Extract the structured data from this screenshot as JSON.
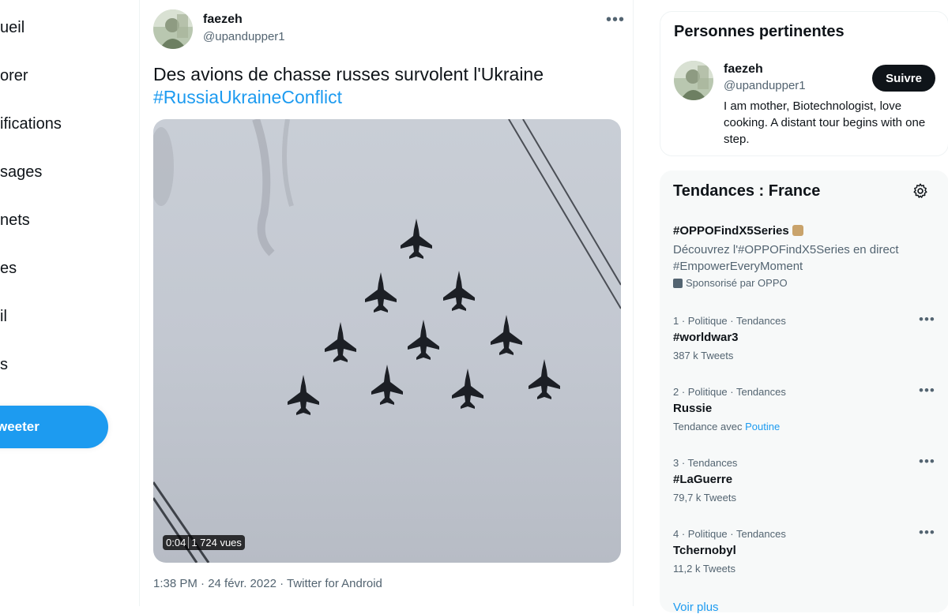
{
  "nav": {
    "items": [
      "ueil",
      "orer",
      "ifications",
      "sages",
      "nets",
      "es",
      "il",
      "s"
    ],
    "tweet_button": "weeter"
  },
  "tweet": {
    "author_name": "faezeh",
    "author_handle": "@upandupper1",
    "more_icon": "more-horizontal-icon",
    "text": "Des avions de chasse russes survolent l'Ukraine",
    "hashtag": "#RussiaUkraineConflict",
    "video_duration": "0:04",
    "video_views": "1 724 vues",
    "meta": "1:38 PM · 24 févr. 2022 · Twitter for Android"
  },
  "people": {
    "title": "Personnes pertinentes",
    "name": "faezeh",
    "handle": "@upandupper1",
    "bio": "I am mother, Biotechnologist, love cooking. A distant tour begins with one step.",
    "follow_label": "Suivre"
  },
  "trends": {
    "title": "Tendances : France",
    "settings_icon": "gear-icon",
    "promoted": {
      "name": "#OPPOFindX5Series",
      "description": "Découvrez l'#OPPOFindX5Series en direct #EmpowerEveryMoment",
      "sponsor": "Sponsorisé par OPPO"
    },
    "items": [
      {
        "meta": "1 · Politique · Tendances",
        "name": "#worldwar3",
        "count": "387 k Tweets"
      },
      {
        "meta": "2 · Politique · Tendances",
        "name": "Russie",
        "count_prefix": "Tendance avec",
        "count_link": "Poutine"
      },
      {
        "meta": "3 · Tendances",
        "name": "#LaGuerre",
        "count": "79,7 k Tweets"
      },
      {
        "meta": "4 · Politique · Tendances",
        "name": "Tchernobyl",
        "count": "11,2 k Tweets"
      }
    ],
    "show_more": "Voir plus"
  },
  "colors": {
    "accent": "#1d9bf0",
    "text": "#0f1419",
    "secondary": "#536471",
    "card_bg": "#f7f9f9"
  }
}
